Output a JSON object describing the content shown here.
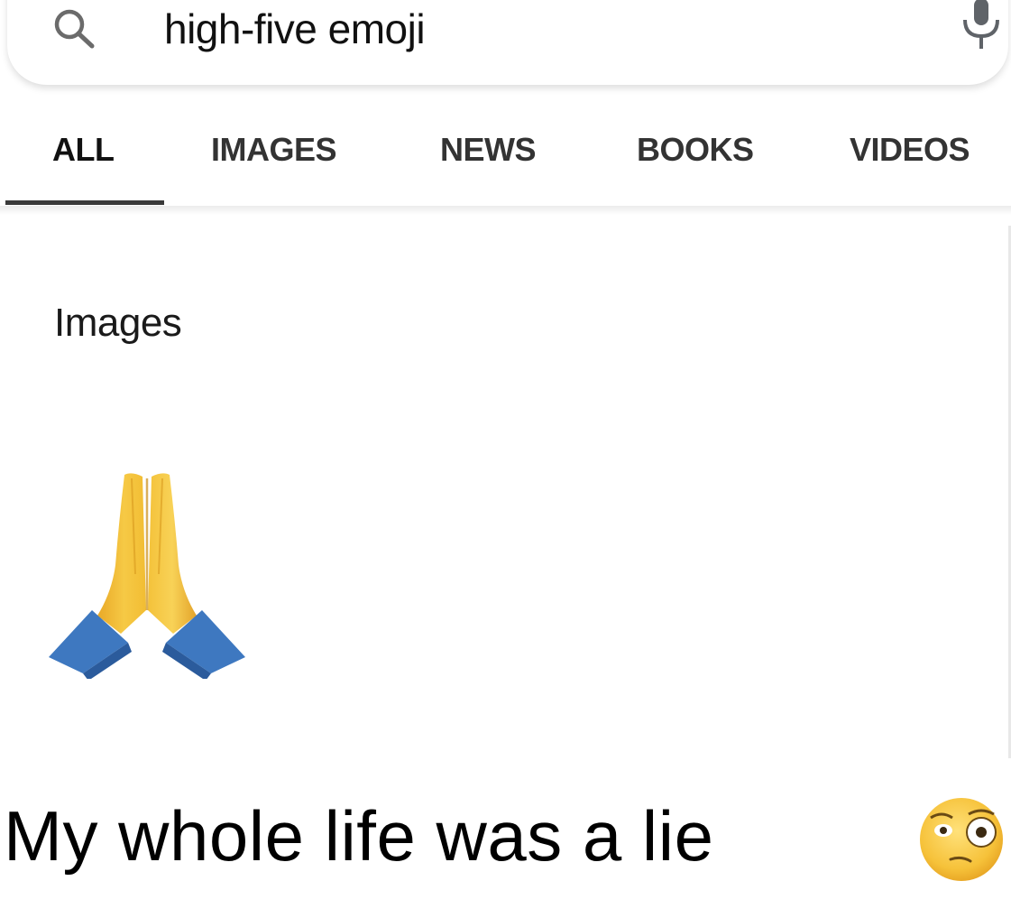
{
  "search": {
    "query": "high-five emoji"
  },
  "tabs": [
    {
      "label": "ALL",
      "selected": true
    },
    {
      "label": "IMAGES",
      "selected": false
    },
    {
      "label": "NEWS",
      "selected": false
    },
    {
      "label": "BOOKS",
      "selected": false
    },
    {
      "label": "VIDEOS",
      "selected": false
    }
  ],
  "results": {
    "section_title": "Images",
    "image_1_icon": "folded-hands-emoji"
  },
  "caption": {
    "text": "My whole life was a lie",
    "emoji_icon": "flushed-face-emoji"
  },
  "colors": {
    "background": "#ffffff",
    "tab_indicator": "#3a3a3a",
    "hand_yellow": "#f3c33c",
    "sleeve_blue": "#3e78c0"
  }
}
